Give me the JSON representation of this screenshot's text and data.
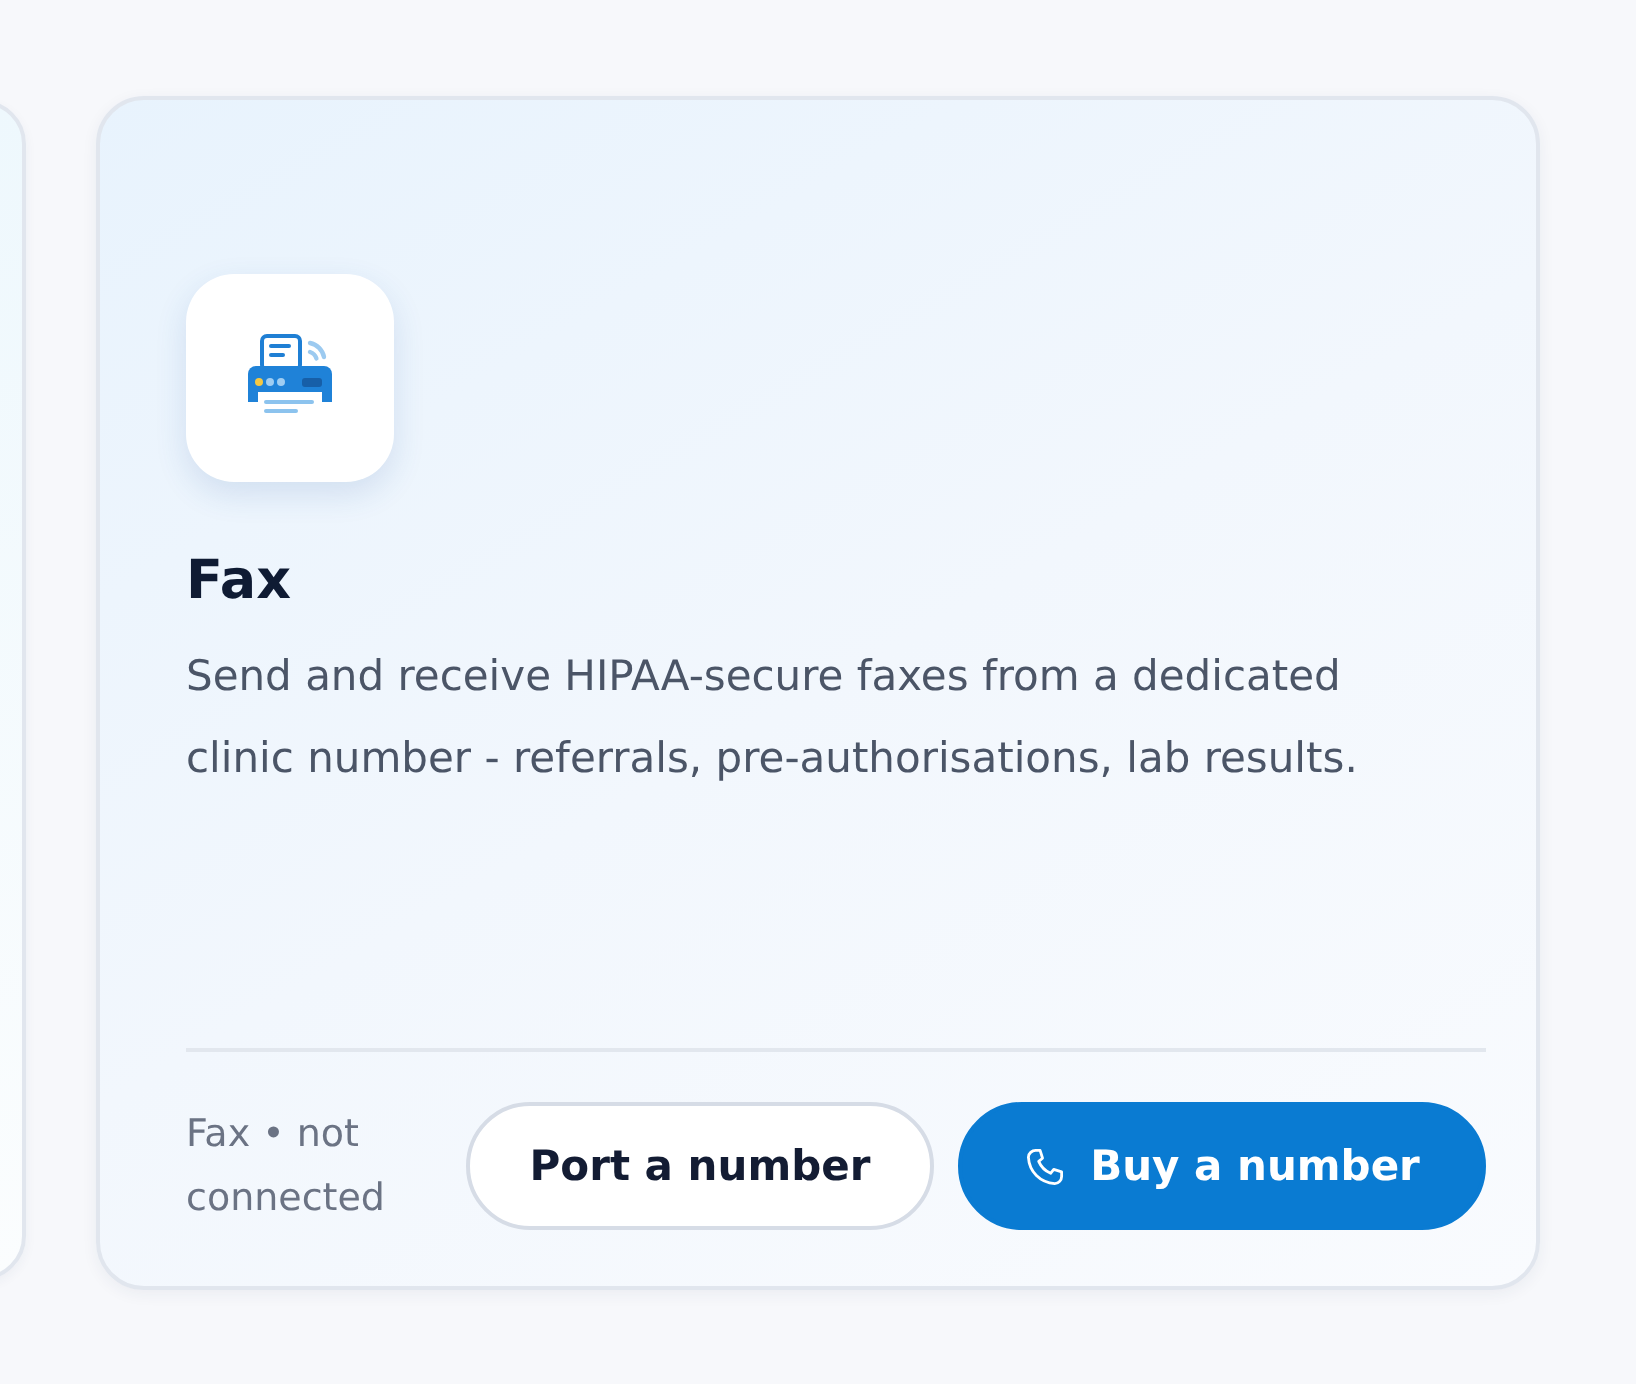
{
  "card": {
    "title": "Fax",
    "description": "Send and receive HIPAA-secure faxes from a dedicated clinic number - referrals, pre-authorisations, lab results.",
    "status": "Fax • not connected",
    "buttons": [
      {
        "label": "Port a number",
        "kind": "secondary"
      },
      {
        "label": "Buy a number",
        "kind": "primary"
      }
    ]
  }
}
